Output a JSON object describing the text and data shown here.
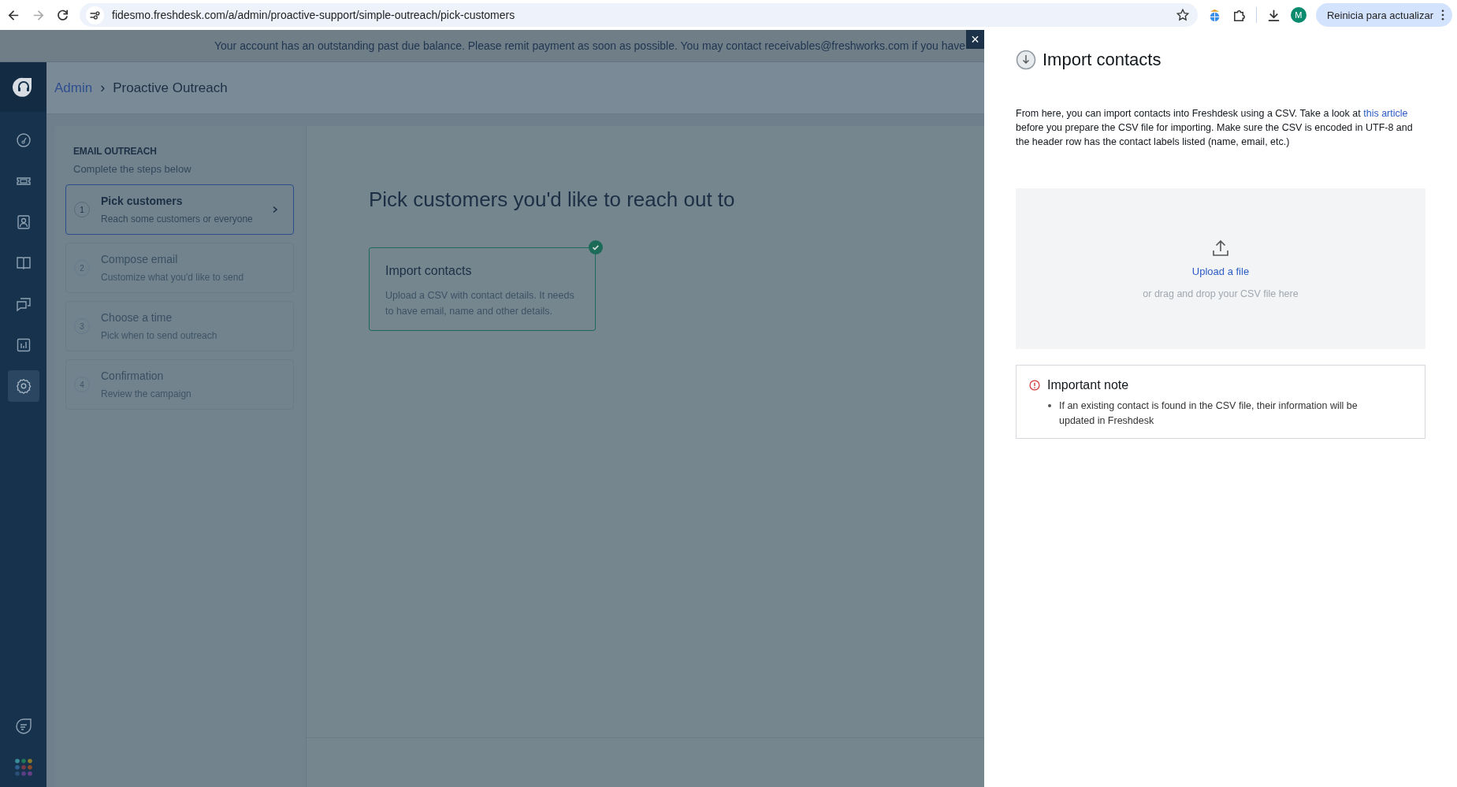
{
  "browser": {
    "url": "fidesmo.freshdesk.com/a/admin/proactive-support/simple-outreach/pick-customers",
    "profile_initial": "M",
    "update_button": "Reinicia para actualizar"
  },
  "banner": {
    "text": "Your account has an outstanding past due balance. Please remit payment as soon as possible. You may contact receivables@freshworks.com if you have"
  },
  "sidebar": {
    "items": [
      {
        "kind": "dashboard",
        "selected": false
      },
      {
        "kind": "tickets",
        "selected": false
      },
      {
        "kind": "contacts",
        "selected": false
      },
      {
        "kind": "knowledge",
        "selected": false
      },
      {
        "kind": "conversations",
        "selected": false
      },
      {
        "kind": "reports",
        "selected": false
      },
      {
        "kind": "settings",
        "selected": true
      }
    ]
  },
  "breadcrumb": {
    "parent": "Admin",
    "separator": "›",
    "current": "Proactive Outreach"
  },
  "steps_panel": {
    "title": "EMAIL OUTREACH",
    "subtitle": "Complete the steps below",
    "steps": [
      {
        "number": "1",
        "title": "Pick customers",
        "subtitle": "Reach some customers or everyone",
        "selected": true,
        "disabled": false
      },
      {
        "number": "2",
        "title": "Compose email",
        "subtitle": "Customize what you'd like to send",
        "selected": false,
        "disabled": true
      },
      {
        "number": "3",
        "title": "Choose a time",
        "subtitle": "Pick when to send outreach",
        "selected": false,
        "disabled": true
      },
      {
        "number": "4",
        "title": "Confirmation",
        "subtitle": "Review the campaign",
        "selected": false,
        "disabled": true
      }
    ]
  },
  "main": {
    "heading": "Pick customers you'd like to reach out to",
    "options": [
      {
        "title": "Import contacts",
        "description": "Upload a CSV with contact details. It needs to have email, name and other details.",
        "checked": true
      }
    ]
  },
  "drawer": {
    "close": "×",
    "title": "Import contacts",
    "intro": "From here, you can import contacts into Freshdesk using a CSV. Take a look at ",
    "intro_link": "this article",
    "intro_rest": " before you prepare the CSV file for importing. Make sure the CSV is encoded in UTF-8 and the header row has the contact labels listed (name, email, etc.)",
    "upload_link": "Upload a file",
    "upload_hint": "or drag and drop your CSV file here",
    "note_title": "Important note",
    "note_items": [
      "If an existing contact is found in the CSV file, their information will be updated in Freshdesk"
    ]
  }
}
